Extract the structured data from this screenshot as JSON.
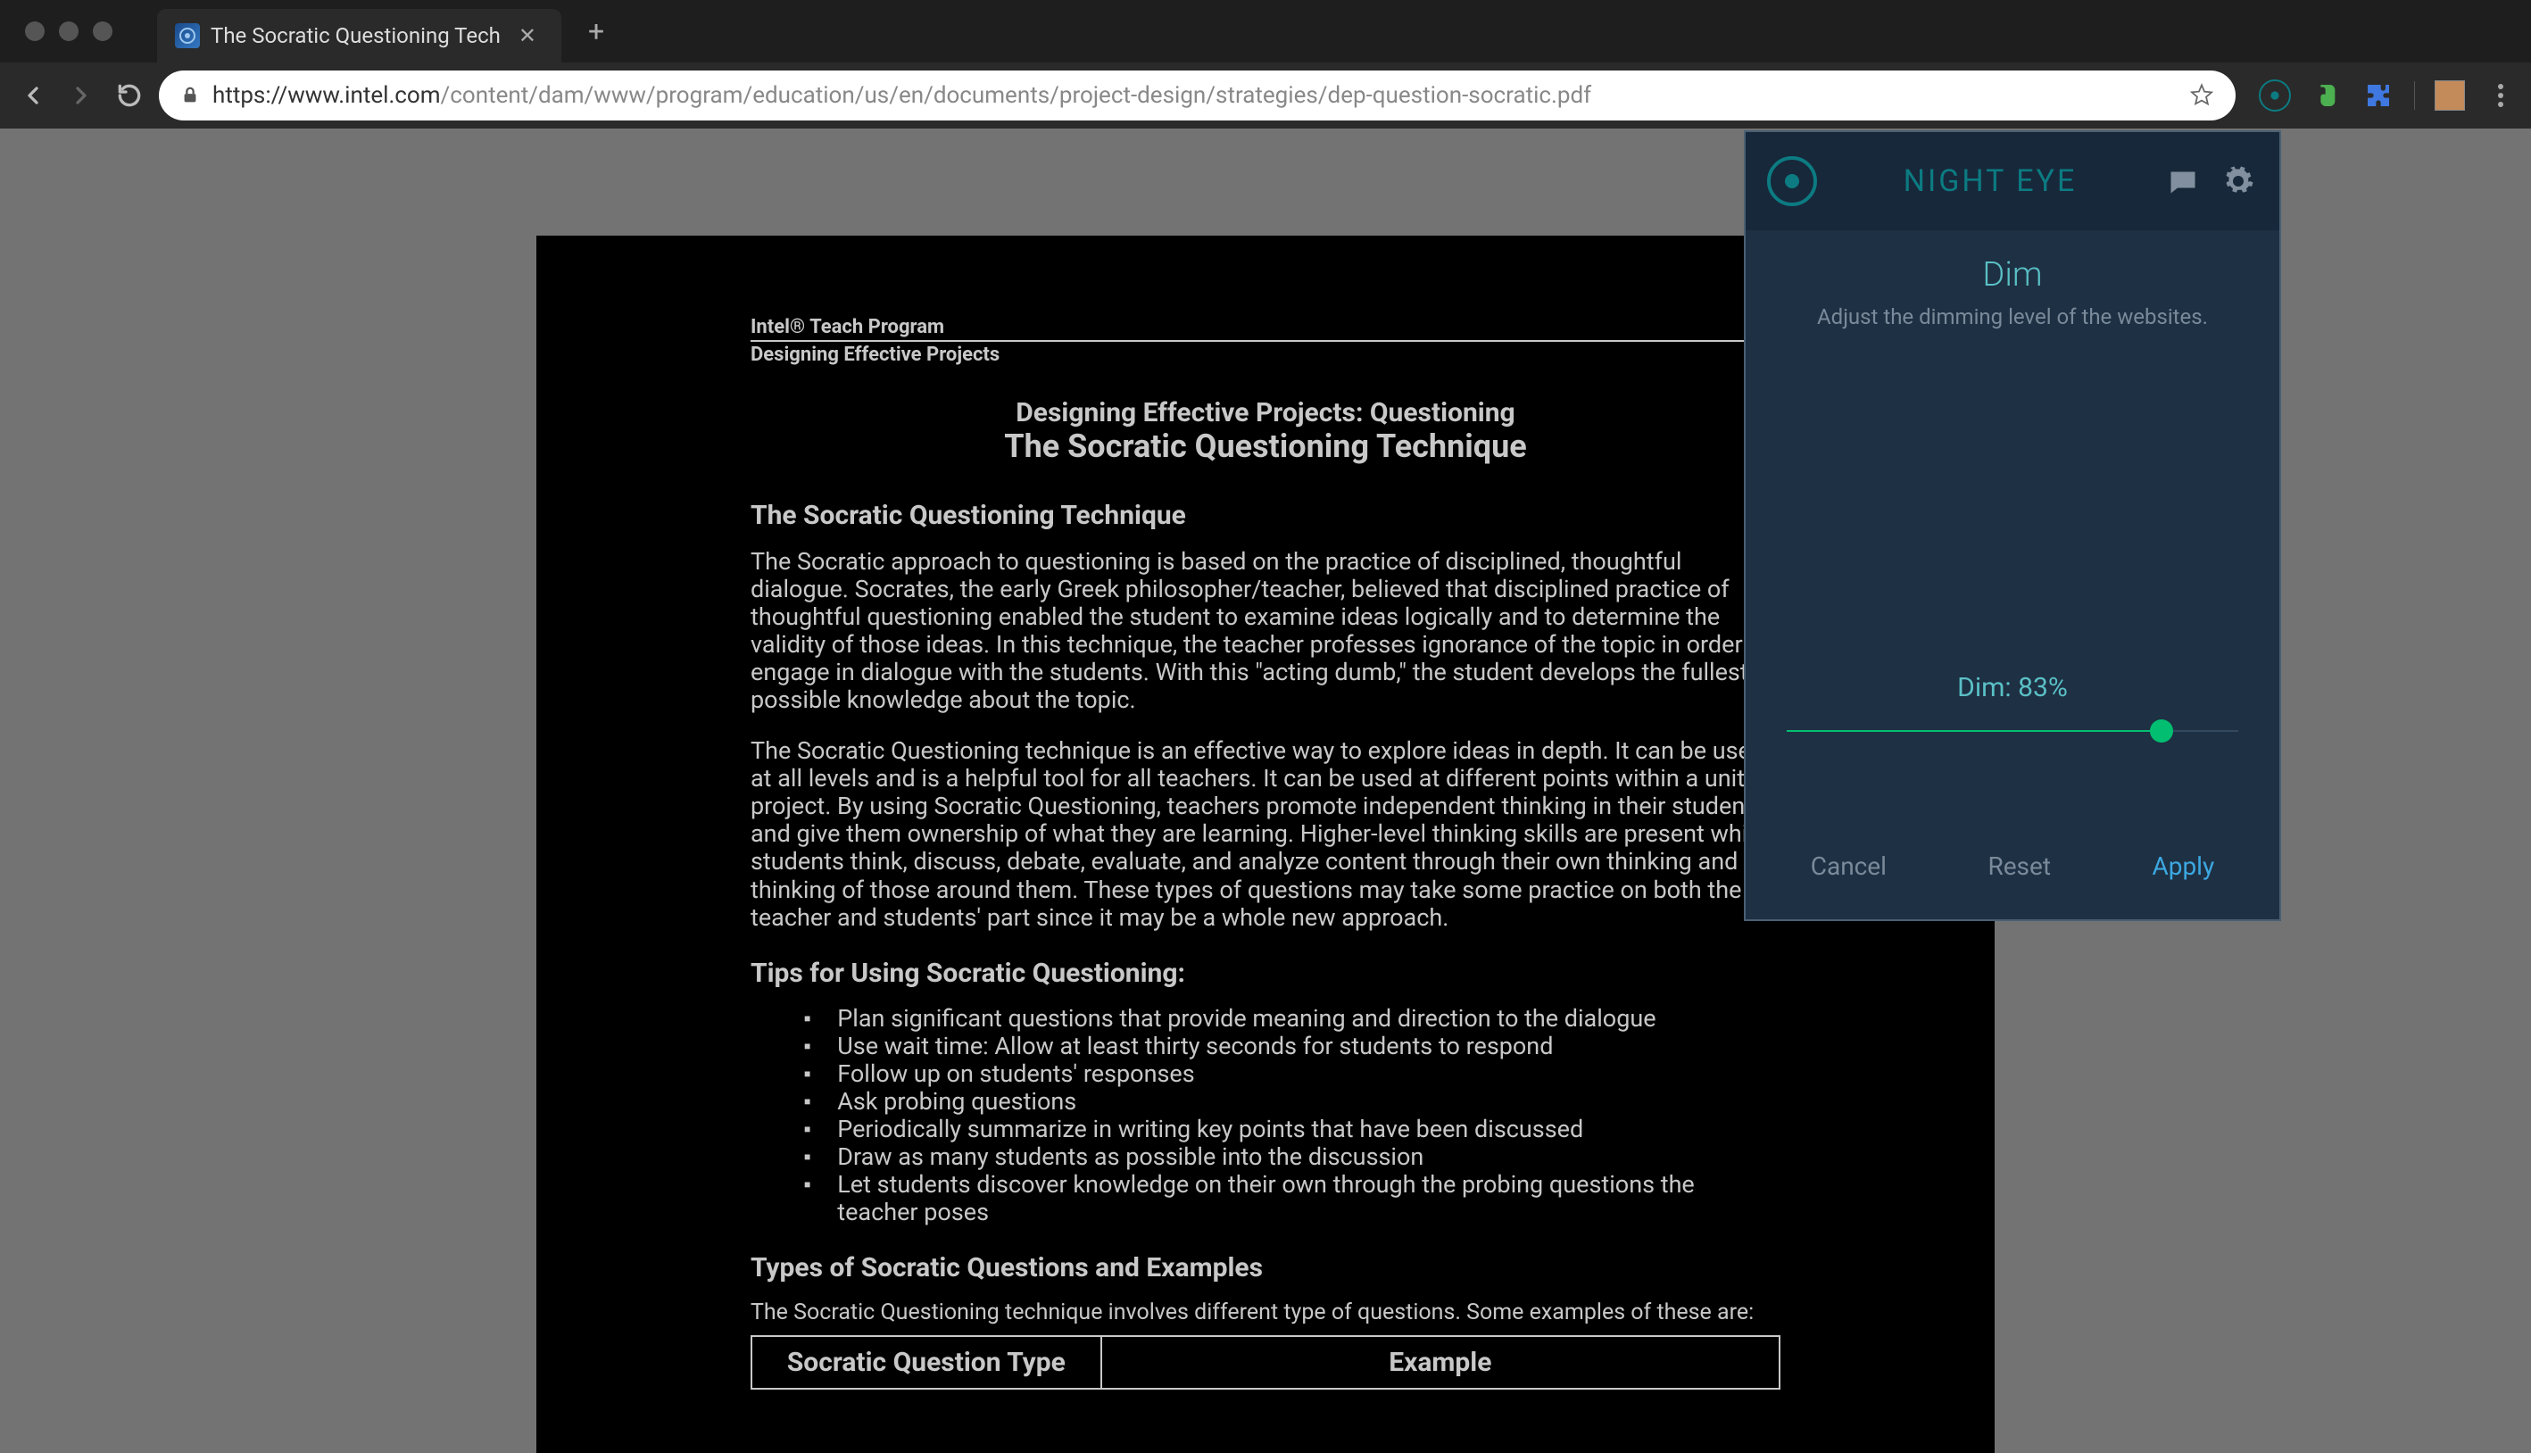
{
  "browser": {
    "tab_title": "The Socratic Questioning Tech",
    "url_host": "https://www.intel.com",
    "url_path": "/content/dam/www/program/education/us/en/documents/project-design/strategies/dep-question-socratic.pdf"
  },
  "pdf": {
    "header1": "Intel® Teach Program",
    "header2": "Designing Effective Projects",
    "title_line1": "Designing Effective Projects: Questioning",
    "title_line2": "The Socratic Questioning Technique",
    "section1": "The Socratic Questioning Technique",
    "para1": "The Socratic approach to questioning is based on the practice of disciplined, thoughtful dialogue. Socrates, the early Greek philosopher/teacher, believed that disciplined practice of thoughtful questioning enabled the student to examine ideas logically and to determine the validity of those ideas. In this technique, the teacher professes ignorance of the topic in order to engage in dialogue with the students. With this \"acting dumb,\" the student develops the fullest possible knowledge about the topic.",
    "para2": "The Socratic Questioning technique is an effective way to explore ideas in depth. It can be used at all levels and is a helpful tool for all teachers. It can be used at different points within a unit or project. By using Socratic Questioning, teachers promote independent thinking in their students and give them ownership of what they are learning. Higher-level thinking skills are present while students think, discuss, debate, evaluate, and analyze content through their own thinking and the thinking of those around them. These types of questions may take some practice on both the teacher and students' part since it may be a whole new approach.",
    "section2": "Tips for Using Socratic Questioning:",
    "tips": [
      "Plan significant questions that provide meaning and direction to the dialogue",
      "Use wait time: Allow at least thirty seconds for students to respond",
      "Follow up on students' responses",
      "Ask probing questions",
      "Periodically summarize in writing key points that have been discussed",
      "Draw as many students as possible into the discussion",
      "Let students discover knowledge on their own through the probing questions the teacher poses"
    ],
    "section3": "Types of Socratic Questions and Examples",
    "para3": "The Socratic Questioning technique involves different type of questions. Some examples of these are:",
    "table_h1": "Socratic Question Type",
    "table_h2": "Example"
  },
  "popup": {
    "title": "NIGHT EYE",
    "section": "Dim",
    "desc": "Adjust the dimming level of the websites.",
    "level_label": "Dim: 83%",
    "level_value": 83,
    "btn_cancel": "Cancel",
    "btn_reset": "Reset",
    "btn_apply": "Apply"
  }
}
